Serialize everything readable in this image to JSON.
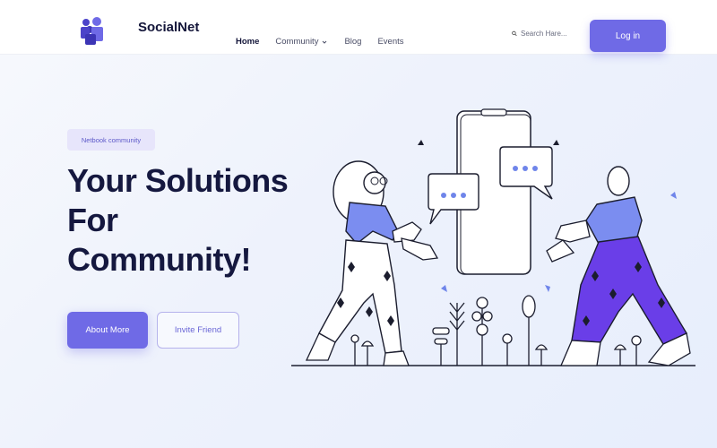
{
  "header": {
    "brand": "SocialNet",
    "nav": [
      {
        "label": "Home",
        "active": true
      },
      {
        "label": "Community",
        "has_dropdown": true
      },
      {
        "label": "Blog"
      },
      {
        "label": "Events"
      }
    ],
    "search_placeholder": "Search Hare...",
    "login_label": "Log in"
  },
  "hero": {
    "badge": "Netbook community",
    "headline_line1": "Your Solutions For",
    "headline_line2": "Community!",
    "primary_button": "About More",
    "secondary_button": "Invite Friend"
  },
  "colors": {
    "accent": "#6f6ae6",
    "dark_text": "#15183f",
    "illustration_blue": "#7b8df0",
    "illustration_purple": "#6a3ee8"
  },
  "icons": {
    "logo": "people-group-icon",
    "search": "search-icon",
    "dropdown": "chevron-down-icon"
  }
}
